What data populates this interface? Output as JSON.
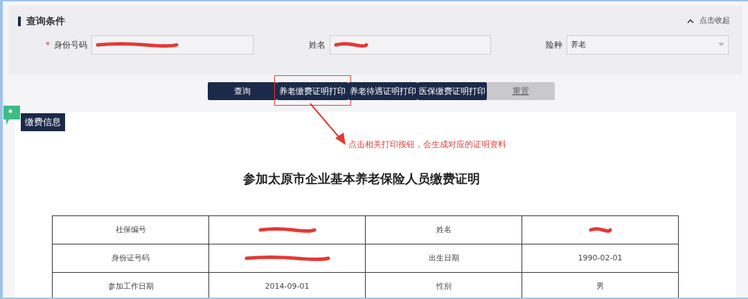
{
  "query_panel": {
    "title": "查询条件",
    "collapse_link": "点击收起",
    "fields": [
      {
        "kind": "input",
        "label": "身份号码",
        "required_mark": "*",
        "redacted": true
      },
      {
        "kind": "input",
        "label": "姓名",
        "redacted": true
      },
      {
        "kind": "select",
        "label": "险种",
        "value": "养老"
      }
    ]
  },
  "buttons": [
    {
      "label": "查询",
      "disabled": false,
      "highlighted": false
    },
    {
      "label": "养老缴费证明打印",
      "disabled": false,
      "highlighted": true
    },
    {
      "label": "养老待遇证明打印",
      "disabled": false,
      "highlighted": false
    },
    {
      "label": "医保缴费证明打印",
      "disabled": false,
      "highlighted": false
    },
    {
      "label": "重置",
      "disabled": true,
      "highlighted": false
    }
  ],
  "annotation": "点击相关打印按钮，会生成对应的证明资料",
  "section_tag": "缴费信息",
  "certificate": {
    "title": "参加太原市企业基本养老保险人员缴费证明",
    "rows": [
      [
        {
          "text": "社保编号"
        },
        {
          "redacted": true
        },
        {
          "text": "姓名"
        },
        {
          "redacted": true
        }
      ],
      [
        {
          "text": "身份证号码"
        },
        {
          "redacted": true
        },
        {
          "text": "出生日期"
        },
        {
          "text": "1990-02-01"
        }
      ],
      [
        {
          "text": "参加工作日期"
        },
        {
          "text": "2014-09-01"
        },
        {
          "text": "性别"
        },
        {
          "text": "男"
        }
      ]
    ]
  }
}
